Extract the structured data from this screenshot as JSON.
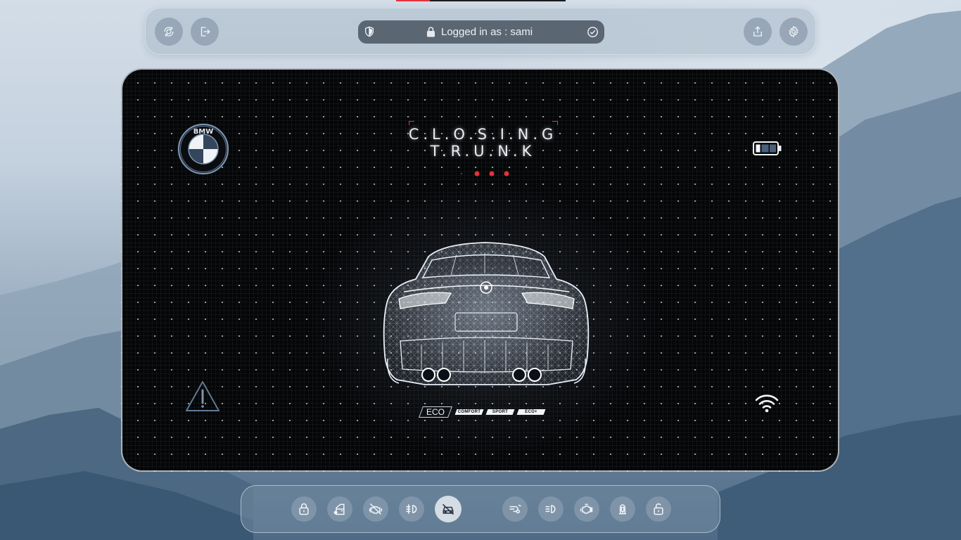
{
  "progress": {
    "percent": 20,
    "color": "#e5323c"
  },
  "topbar": {
    "left_buttons": [
      {
        "icon": "camera-rotate-icon"
      },
      {
        "icon": "logout-icon"
      }
    ],
    "login": {
      "text": "Logged in as : sami",
      "left_icon": "shield-icon",
      "lock_icon": "lock-icon",
      "right_icon": "check-circle-icon"
    },
    "right_buttons": [
      {
        "icon": "share-icon"
      },
      {
        "icon": "gear-icon"
      }
    ]
  },
  "panel": {
    "brand_logo": "bmw-logo",
    "brand_letters": "BMW",
    "title_line1": "C.L.O.S.I.N.G",
    "title_line2": "T.R.U.N.K",
    "status_indicator_color": "#e5323c",
    "battery_icon": "battery-icon",
    "warning_icon": "warning-icon",
    "wifi_icon": "wifi-icon",
    "drive_modes": [
      {
        "label": "ECO",
        "active": true
      },
      {
        "label": "COMFORT",
        "active": false
      },
      {
        "label": "SPORT",
        "active": false
      },
      {
        "label": "ECO+",
        "active": false
      }
    ]
  },
  "dock": {
    "items": [
      {
        "icon": "lock-icon",
        "active": false
      },
      {
        "icon": "car-door-icon",
        "active": false
      },
      {
        "icon": "engine-off-icon",
        "active": false
      },
      {
        "icon": "fog-light-icon",
        "active": false
      },
      {
        "icon": "car-off-icon",
        "active": true
      },
      {
        "icon": "wiper-icon",
        "active": false
      },
      {
        "icon": "headlight-icon",
        "active": false
      },
      {
        "icon": "engine-icon",
        "active": false
      },
      {
        "icon": "seatbelt-icon",
        "active": false
      },
      {
        "icon": "unlock-icon",
        "active": false
      }
    ]
  }
}
